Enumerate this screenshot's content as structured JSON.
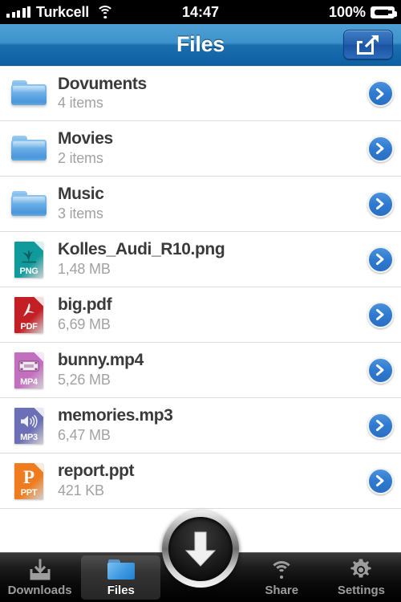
{
  "status_bar": {
    "carrier": "Turkcell",
    "time": "14:47",
    "battery_percent": "100%",
    "signal_icon": "signal-bars-icon",
    "wifi_icon": "wifi-icon",
    "battery_icon": "battery-full-charging-icon"
  },
  "nav_bar": {
    "title": "Files",
    "share_icon": "share-export-icon"
  },
  "list": {
    "rows": [
      {
        "name": "Dovuments",
        "detail": "4 items",
        "kind": "folder",
        "ext": "",
        "color": "#5aa6e4"
      },
      {
        "name": "Movies",
        "detail": "2 items",
        "kind": "folder",
        "ext": "",
        "color": "#5aa6e4"
      },
      {
        "name": "Music",
        "detail": "3 items",
        "kind": "folder",
        "ext": "",
        "color": "#5aa6e4"
      },
      {
        "name": "Kolles_Audi_R10.png",
        "detail": "1,48 MB",
        "kind": "file",
        "ext": "PNG",
        "color": "#119a9b"
      },
      {
        "name": "big.pdf",
        "detail": "6,69 MB",
        "kind": "file",
        "ext": "PDF",
        "color": "#c32026"
      },
      {
        "name": "bunny.mp4",
        "detail": "5,26 MB",
        "kind": "file",
        "ext": "MP4",
        "color": "#c36fc0"
      },
      {
        "name": "memories.mp3",
        "detail": "6,47 MB",
        "kind": "file",
        "ext": "MP3",
        "color": "#6b6fb5"
      },
      {
        "name": "report.ppt",
        "detail": "421 KB",
        "kind": "file",
        "ext": "PPT",
        "color": "#ef7c1f"
      }
    ],
    "disclosure_icon": "chevron-right-icon"
  },
  "tab_bar": {
    "tabs": [
      {
        "label": "Downloads",
        "icon": "download-tray-icon",
        "selected": false
      },
      {
        "label": "Files",
        "icon": "folder-icon",
        "selected": true
      },
      {
        "label": "Share",
        "icon": "wifi-share-icon",
        "selected": false
      },
      {
        "label": "Settings",
        "icon": "gear-icon",
        "selected": false
      }
    ],
    "center_button": {
      "icon": "download-arrow-icon",
      "label": ""
    }
  },
  "colors": {
    "nav_blue": "#2f82c4",
    "accent_blue": "#2f7ad0",
    "tab_selected_text": "#ffffff",
    "tab_text": "#9d9d9d"
  }
}
